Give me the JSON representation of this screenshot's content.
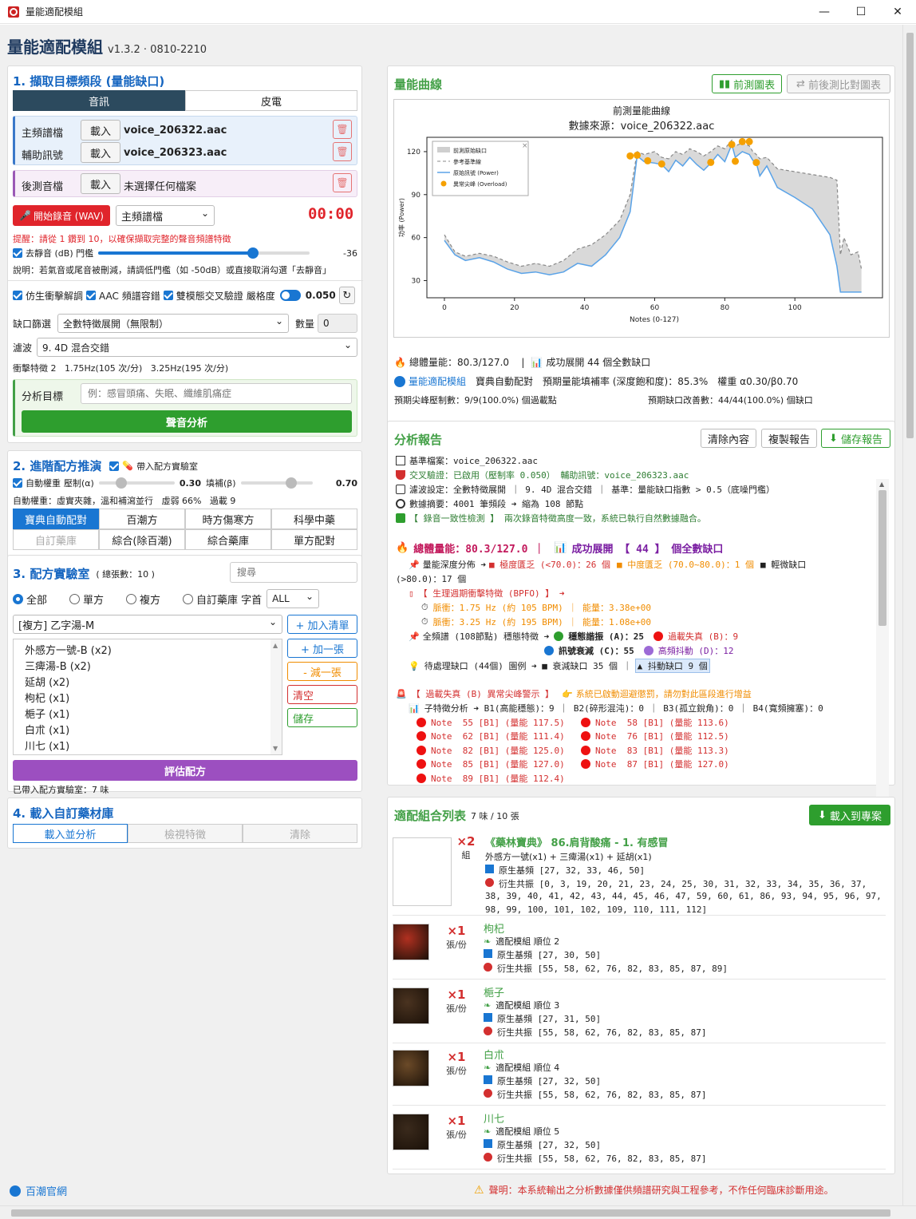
{
  "window": {
    "title": "量能適配模組",
    "min": "—",
    "max": "☐",
    "close": "✕"
  },
  "app": {
    "title": "量能適配模組",
    "version": "v1.3.2 · 0810-2210"
  },
  "s1": {
    "title": "1. 擷取目標頻段 (量能缺口)",
    "tab_audio": "音訊",
    "tab_skin": "皮電",
    "main_label": "主頻譜檔",
    "load": "載入",
    "main_file": "voice_206322.aac",
    "aux_label": "輔助訊號",
    "aux_file": "voice_206323.aac",
    "post_label": "後測音檔",
    "post_file": "未選擇任何檔案",
    "record_btn": "開始錄音 (WAV)",
    "record_target": "主頻譜檔",
    "timer": "00:00",
    "hint": "提醒：請從 1 鑽到 10，以確保擷取完整的聲音頻譜特徵",
    "denoise_label": "去靜音 (dB) 門檻",
    "denoise_value": "-36",
    "denoise_level": 0.73,
    "note": "說明：若氣音或尾音被刪減，請調低門檻（如 -50dB）或直接取消勾選「去靜音」",
    "opt1": "仿生衝擊解調",
    "opt2": "AAC 頻譜容錯",
    "opt3": "雙模態交叉驗證",
    "strict_label": "嚴格度",
    "strict_value": "0.050",
    "gap_label": "缺口篩選",
    "gap_value": "全數特徵展開（無限制）",
    "qty_label": "數量",
    "qty_value": "0",
    "filter_label": "濾波",
    "filter_value": "9. 4D 混合交錯",
    "impulse": "衝擊特徵 2   1.75Hz(105 次/分)   3.25Hz(195 次/分)",
    "target_label": "分析目標",
    "target_placeholder": "例：感冒頭痛、失眠、纖維肌痛症",
    "analyze_btn": "聲音分析"
  },
  "s2": {
    "title": "2. 進階配方推演",
    "lab_chk": "帶入配方實驗室",
    "auto_label": "自動權重",
    "alpha_label": "壓制(α)",
    "alpha_value": "0.30",
    "alpha_level": 0.3,
    "beta_label": "填補(β)",
    "beta_value": "0.70",
    "beta_level": 0.7,
    "auto_desc": "自動權重：虛實夾雜，溫和補瀉並行   虛弱 66%   過載 9",
    "tabs": [
      "寶典自動配對",
      "百潮方",
      "時方傷寒方",
      "科學中藥",
      "自訂藥庫",
      "綜合(除百潮)",
      "綜合藥庫",
      "單方配對"
    ]
  },
  "s3": {
    "title": "3. 配方實驗室",
    "count": "( 總張數：10 )",
    "search_placeholder": "搜尋",
    "radios": [
      "全部",
      "單方",
      "複方",
      "自訂藥庫"
    ],
    "initial_label": "字首",
    "initial_value": "ALL",
    "formula": "[複方] 乙字湯-M",
    "list": [
      "外感方一號-B (x2)",
      "三痺湯-B (x2)",
      "延胡 (x2)",
      "枸杞 (x1)",
      "梔子 (x1)",
      "白朮 (x1)",
      "川七 (x1)"
    ],
    "btn_add_list": "+ 加入清單",
    "btn_add_one": "+ 加一張",
    "btn_minus_one": "- 減一張",
    "btn_clear": "清空",
    "btn_save": "儲存",
    "eval_btn": "評估配方",
    "status": "已帶入配方實驗室：7 味"
  },
  "s4": {
    "title": "4. 載入自訂藥材庫",
    "tabs": [
      "載入並分析",
      "檢視特徵",
      "清除"
    ]
  },
  "footer": {
    "link": "百潮官網",
    "disclaimer": "聲明：本系統輸出之分析數據僅供頻譜研究與工程參考，不作任何臨床診斷用途。"
  },
  "curve": {
    "title": "量能曲線",
    "btn_pre": "前測圖表",
    "btn_compare": "前後測比對圖表",
    "summary1": "總體量能：80.3/127.0    |",
    "summary1b": "成功展開 44 個全數缺口",
    "module": "量能適配模組",
    "m2": "寶典自動配對",
    "m3": "預期量能填補率 (深度飽和度)：85.3%",
    "m4": "權重 α0.30/β0.70",
    "peak": "預期尖峰壓制數：9/9(100.0%) 個過載點",
    "gap": "預期缺口改善數：44/44(100.0%) 個缺口"
  },
  "report": {
    "title": "分析報告",
    "btn_clear": "清除內容",
    "btn_copy": "複製報告",
    "btn_save": "儲存報告",
    "lines": [
      "基準檔案：voice_206322.aac",
      "交叉驗證：已啟用（壓制率 0.050）  輔助訊號：voice_206323.aac",
      "濾波設定：全數特徵展開 ｜ 9. 4D 混合交錯 ｜ 基準：量能缺口指數 > 0.5（底噪門檻）",
      "數據摘要：4001 筆頻段 ➜ 縮為 108 節點",
      "【 錄音一致性檢測 】 兩次錄音特徵高度一致，系統已執行自然數據融合。",
      "總體量能：80.3/127.0  ｜",
      "成功展開 【 44 】 個全數缺口",
      "量能深度分佈 ➜",
      "■ 極度匱乏 (<70.0)：26 個",
      "■ 中度匱乏 (70.0~80.0)：1 個",
      "■ 輕微缺口",
      "(>80.0)：17 個",
      "【 生理週期衝擊特徵 (BPFO) 】 ➜",
      "脈衝：1.75 Hz (約 105 BPM) ｜ 能量：3.38e+00",
      "脈衝：3.25 Hz (約 195 BPM) ｜ 能量：1.08e+00",
      "全頻譜 (108節點) 穩態特徵 ➜",
      "穩態諧振 (A)：25",
      "過載失真 (B)：9",
      "訊號衰減 (C)：55",
      "高頻抖動 (D)：12",
      "待處理缺口 (44個) 園例 ➜ ■ 衰減缺口 35 個 ｜",
      "▲ 抖動缺口 9 個",
      "【 過載失真 (B) 異常尖峰警示 】",
      "系統已啟動迴避懲罰，請勿對此區段進行增益",
      "子特徵分析 ➜ B1(高能穩態)：9 ｜ B2(碎形混沌)：0 ｜ B3(孤立銳角)：0 ｜ B4(寬頻擁塞)：0"
    ],
    "notes": [
      "Note  55 [B1] (量能 117.5)",
      "Note  58 [B1] (量能 113.6)",
      "Note  62 [B1] (量能 111.4)",
      "Note  76 [B1] (量能 112.5)",
      "Note  82 [B1] (量能 125.0)",
      "Note  83 [B1] (量能 113.3)",
      "Note  85 [B1] (量能 127.0)",
      "Note  87 [B1] (量能 127.0)",
      "Note  89 [B1] (量能 112.4)"
    ]
  },
  "combo": {
    "title": "適配組合列表",
    "count": "7 味 / 10 張",
    "btn_load": "載入到專案",
    "items": [
      {
        "mult": "×2",
        "unit": "組",
        "name": "《藥林寶典》 86.肩背酸痛 - 1. 有感冒",
        "sub": "外感方一號(x1) + 三痺湯(x1) + 延胡(x1)",
        "l1": "原生基頻 [27, 32, 33, 46, 50]",
        "l2": "衍生共振 [0, 3, 19, 20, 21, 23, 24, 25, 30, 31, 32, 33, 34, 35, 36, 37,",
        "l3": "38, 39, 40, 41, 42, 43, 44, 45, 46, 47, 59, 60, 61, 86, 93, 94, 95, 96, 97,",
        "l4": "98, 99, 100, 101, 102, 109, 110, 111, 112]"
      },
      {
        "mult": "×1",
        "unit": "張/份",
        "name": "枸杞",
        "l0": "適配模組 順位 2",
        "l1": "原生基頻 [27, 30, 50]",
        "l2": "衍生共振 [55, 58, 62, 76, 82, 83, 85, 87, 89]",
        "color": "#b03020"
      },
      {
        "mult": "×1",
        "unit": "張/份",
        "name": "梔子",
        "l0": "適配模組 順位 3",
        "l1": "原生基頻 [27, 31, 50]",
        "l2": "衍生共振 [55, 58, 62, 76, 82, 83, 85, 87]",
        "color": "#4a3320"
      },
      {
        "mult": "×1",
        "unit": "張/份",
        "name": "白朮",
        "l0": "適配模組 順位 4",
        "l1": "原生基頻 [27, 32, 50]",
        "l2": "衍生共振 [55, 58, 62, 76, 82, 83, 85, 87]",
        "color": "#6b4a28"
      },
      {
        "mult": "×1",
        "unit": "張/份",
        "name": "川七",
        "l0": "適配模組 順位 5",
        "l1": "原生基頻 [27, 32, 50]",
        "l2": "衍生共振 [55, 58, 62, 76, 82, 83, 85, 87]",
        "color": "#3a2a1c"
      }
    ]
  },
  "chart_data": {
    "type": "line",
    "title": "前測量能曲線",
    "subtitle": "數據來源：voice_206322.aac",
    "xlabel": "Notes (0-127)",
    "ylabel": "功率 (Power)",
    "xlim": [
      -5,
      125
    ],
    "ylim": [
      18,
      130
    ],
    "xticks": [
      0,
      20,
      40,
      60,
      80,
      100
    ],
    "yticks": [
      30,
      60,
      90,
      120
    ],
    "legend": [
      "前測原始缺口",
      "參考基準線",
      "原始訊號 (Power)",
      "異常尖峰 (Overload)"
    ],
    "x": [
      0,
      3,
      6,
      10,
      14,
      18,
      22,
      26,
      30,
      34,
      38,
      42,
      46,
      50,
      53,
      55,
      57,
      60,
      62,
      64,
      66,
      68,
      70,
      72,
      74,
      76,
      78,
      80,
      82,
      83,
      85,
      87,
      88,
      89,
      90,
      92,
      95,
      100,
      105,
      110,
      112,
      113,
      114,
      116,
      118,
      119
    ],
    "power": [
      58,
      48,
      44,
      46,
      43,
      38,
      35,
      36,
      34,
      36,
      42,
      40,
      48,
      60,
      78,
      117,
      113,
      112,
      111,
      106,
      114,
      110,
      116,
      111,
      107,
      112,
      118,
      113,
      125,
      116,
      120,
      118,
      114,
      112,
      103,
      110,
      95,
      88,
      80,
      62,
      40,
      22,
      22,
      22,
      22,
      22
    ],
    "reference": [
      62,
      50,
      47,
      49,
      47,
      43,
      40,
      42,
      40,
      44,
      52,
      55,
      62,
      72,
      90,
      120,
      118,
      120,
      116,
      115,
      120,
      118,
      122,
      120,
      117,
      120,
      124,
      122,
      128,
      124,
      126,
      124,
      120,
      118,
      115,
      116,
      108,
      106,
      104,
      102,
      100,
      48,
      60,
      48,
      50,
      38
    ],
    "overload": [
      [
        55,
        117.5
      ],
      [
        58,
        113.6
      ],
      [
        62,
        111.4
      ],
      [
        76,
        112.5
      ],
      [
        82,
        125.0
      ],
      [
        83,
        113.3
      ],
      [
        85,
        127.0
      ],
      [
        87,
        127.0
      ],
      [
        89,
        112.4
      ],
      [
        53,
        117
      ]
    ]
  }
}
